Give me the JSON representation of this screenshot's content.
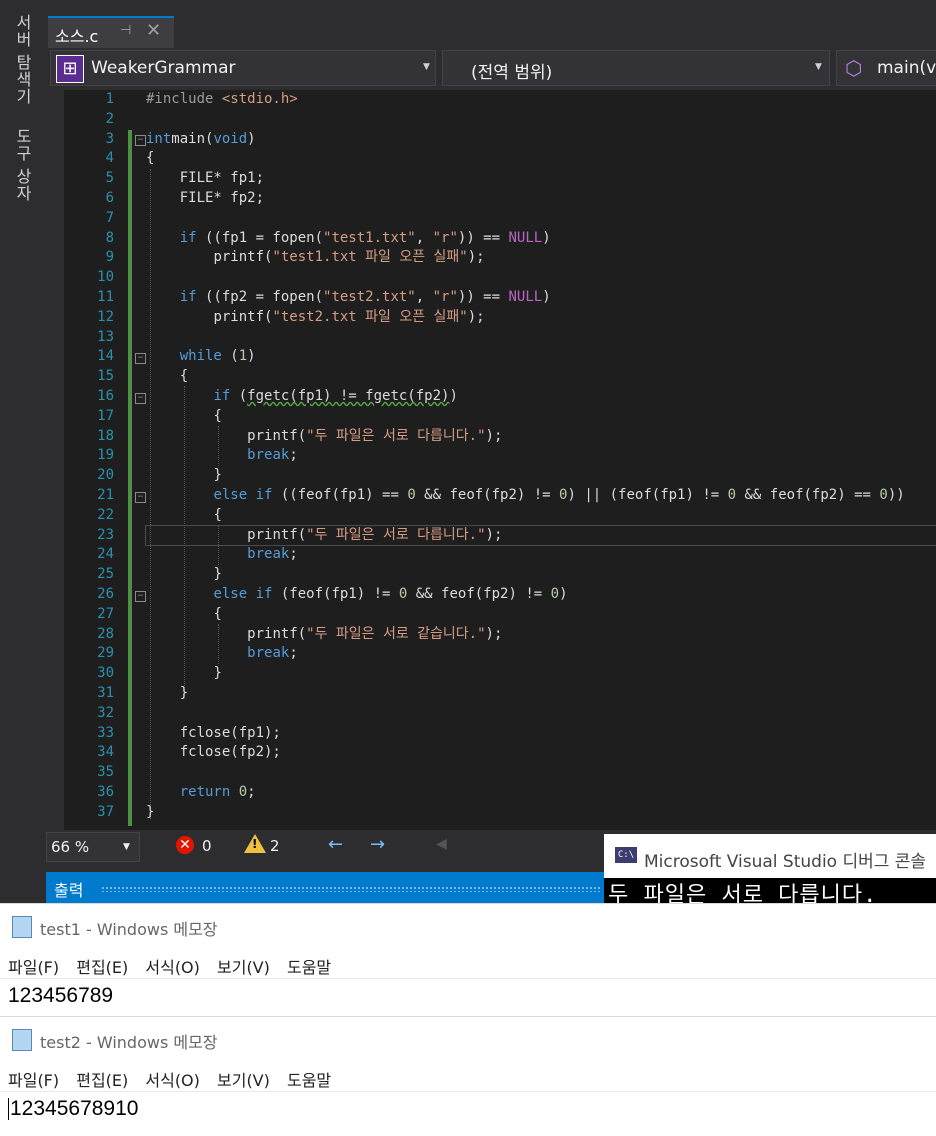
{
  "side_tabs": [
    "서버 탐색기",
    "도구 상자"
  ],
  "tab": {
    "name": "소스.c"
  },
  "nav": {
    "project": "WeakerGrammar",
    "scope": "(전역 범위)",
    "member": "main(void)"
  },
  "line_numbers": [
    "1",
    "2",
    "3",
    "4",
    "5",
    "6",
    "7",
    "8",
    "9",
    "10",
    "11",
    "12",
    "13",
    "14",
    "15",
    "16",
    "17",
    "18",
    "19",
    "20",
    "21",
    "22",
    "23",
    "24",
    "25",
    "26",
    "27",
    "28",
    "29",
    "30",
    "31",
    "32",
    "33",
    "34",
    "35",
    "36",
    "37"
  ],
  "code": [
    {
      "i": "",
      "t": [
        [
          "pp",
          "#include "
        ],
        [
          "inc",
          "<stdio.h>"
        ]
      ]
    },
    {
      "i": "",
      "t": []
    },
    {
      "i": "",
      "t": [
        [
          "kw",
          "int"
        ],
        [
          "",
          "main("
        ],
        [
          "kw",
          "void"
        ],
        [
          "",
          ")"
        ]
      ]
    },
    {
      "i": "",
      "t": [
        [
          "",
          "{"
        ]
      ]
    },
    {
      "i": "    ",
      "t": [
        [
          "",
          "FILE* fp1;"
        ]
      ]
    },
    {
      "i": "    ",
      "t": [
        [
          "",
          "FILE* fp2;"
        ]
      ]
    },
    {
      "i": "",
      "t": []
    },
    {
      "i": "    ",
      "t": [
        [
          "kw",
          "if"
        ],
        [
          "",
          " ((fp1 = fopen("
        ],
        [
          "str",
          "\"test1.txt\""
        ],
        [
          "",
          ", "
        ],
        [
          "str",
          "\"r\""
        ],
        [
          "",
          "))"
        ],
        [
          "",
          " == "
        ],
        [
          "mac",
          "NULL"
        ],
        [
          "",
          ")"
        ]
      ]
    },
    {
      "i": "        ",
      "t": [
        [
          "",
          "printf("
        ],
        [
          "str",
          "\"test1.txt 파일 오픈 실패\""
        ],
        [
          "",
          ");"
        ]
      ]
    },
    {
      "i": "",
      "t": []
    },
    {
      "i": "    ",
      "t": [
        [
          "kw",
          "if"
        ],
        [
          "",
          " ((fp2 = fopen("
        ],
        [
          "str",
          "\"test2.txt\""
        ],
        [
          "",
          ", "
        ],
        [
          "str",
          "\"r\""
        ],
        [
          "",
          "))"
        ],
        [
          "",
          " == "
        ],
        [
          "mac",
          "NULL"
        ],
        [
          "",
          ")"
        ]
      ]
    },
    {
      "i": "        ",
      "t": [
        [
          "",
          "printf("
        ],
        [
          "str",
          "\"test2.txt 파일 오픈 실패\""
        ],
        [
          "",
          ");"
        ]
      ]
    },
    {
      "i": "",
      "t": []
    },
    {
      "i": "    ",
      "t": [
        [
          "kw",
          "while"
        ],
        [
          "",
          " ("
        ],
        [
          "num",
          "1"
        ],
        [
          "",
          ")"
        ]
      ]
    },
    {
      "i": "    ",
      "t": [
        [
          "",
          "{"
        ]
      ]
    },
    {
      "i": "        ",
      "t": [
        [
          "kw",
          "if"
        ],
        [
          "",
          " ("
        ],
        [
          "squig",
          "fgetc(fp1) != fgetc(fp2)"
        ],
        [
          "",
          ")"
        ]
      ]
    },
    {
      "i": "        ",
      "t": [
        [
          "",
          "{"
        ]
      ]
    },
    {
      "i": "            ",
      "t": [
        [
          "",
          "printf("
        ],
        [
          "str",
          "\"두 파일은 서로 다릅니다.\""
        ],
        [
          "",
          ");"
        ]
      ]
    },
    {
      "i": "            ",
      "t": [
        [
          "kw",
          "break"
        ],
        [
          "",
          ";"
        ]
      ]
    },
    {
      "i": "        ",
      "t": [
        [
          "",
          "}"
        ]
      ]
    },
    {
      "i": "        ",
      "t": [
        [
          "kw",
          "else"
        ],
        [
          "",
          " "
        ],
        [
          "kw",
          "if"
        ],
        [
          "",
          " ((feof(fp1) == "
        ],
        [
          "num",
          "0"
        ],
        [
          "",
          " && feof(fp2) != "
        ],
        [
          "num",
          "0"
        ],
        [
          "",
          ") || (feof(fp1) != "
        ],
        [
          "num",
          "0"
        ],
        [
          "",
          " && feof(fp2) == "
        ],
        [
          "num",
          "0"
        ],
        [
          "",
          "))"
        ]
      ]
    },
    {
      "i": "        ",
      "t": [
        [
          "",
          "{"
        ]
      ]
    },
    {
      "i": "            ",
      "t": [
        [
          "",
          "printf("
        ],
        [
          "str",
          "\"두 파일은 서로 다릅니다.\""
        ],
        [
          "",
          ");"
        ]
      ]
    },
    {
      "i": "            ",
      "t": [
        [
          "kw",
          "break"
        ],
        [
          "",
          ";"
        ]
      ]
    },
    {
      "i": "        ",
      "t": [
        [
          "",
          "}"
        ]
      ]
    },
    {
      "i": "        ",
      "t": [
        [
          "kw",
          "else"
        ],
        [
          "",
          " "
        ],
        [
          "kw",
          "if"
        ],
        [
          "",
          " (feof(fp1) != "
        ],
        [
          "num",
          "0"
        ],
        [
          "",
          " && feof(fp2) != "
        ],
        [
          "num",
          "0"
        ],
        [
          "",
          ")"
        ]
      ]
    },
    {
      "i": "        ",
      "t": [
        [
          "",
          "{"
        ]
      ]
    },
    {
      "i": "            ",
      "t": [
        [
          "",
          "printf("
        ],
        [
          "str",
          "\"두 파일은 서로 같습니다.\""
        ],
        [
          "",
          ");"
        ]
      ]
    },
    {
      "i": "            ",
      "t": [
        [
          "kw",
          "break"
        ],
        [
          "",
          ";"
        ]
      ]
    },
    {
      "i": "        ",
      "t": [
        [
          "",
          "}"
        ]
      ]
    },
    {
      "i": "    ",
      "t": [
        [
          "",
          "}"
        ]
      ]
    },
    {
      "i": "",
      "t": []
    },
    {
      "i": "    ",
      "t": [
        [
          "",
          "fclose(fp1);"
        ]
      ]
    },
    {
      "i": "    ",
      "t": [
        [
          "",
          "fclose(fp2);"
        ]
      ]
    },
    {
      "i": "",
      "t": []
    },
    {
      "i": "    ",
      "t": [
        [
          "kw",
          "return"
        ],
        [
          "",
          " "
        ],
        [
          "num",
          "0"
        ],
        [
          "",
          ";"
        ]
      ]
    },
    {
      "i": "",
      "t": [
        [
          "",
          "}"
        ]
      ]
    }
  ],
  "status": {
    "zoom": "66 %",
    "errors": "0",
    "warnings": "2"
  },
  "output": {
    "label": "출력"
  },
  "console": {
    "title": "Microsoft Visual Studio 디버그 콘솔",
    "output": "두 파일은 서로 다릅니다."
  },
  "notepads": [
    {
      "title": "test1 - Windows 메모장",
      "content": "123456789"
    },
    {
      "title": "test2 - Windows 메모장",
      "content": "12345678910"
    }
  ],
  "notepad_menu": [
    "파일(F)",
    "편집(E)",
    "서식(O)",
    "보기(V)",
    "도움말"
  ]
}
